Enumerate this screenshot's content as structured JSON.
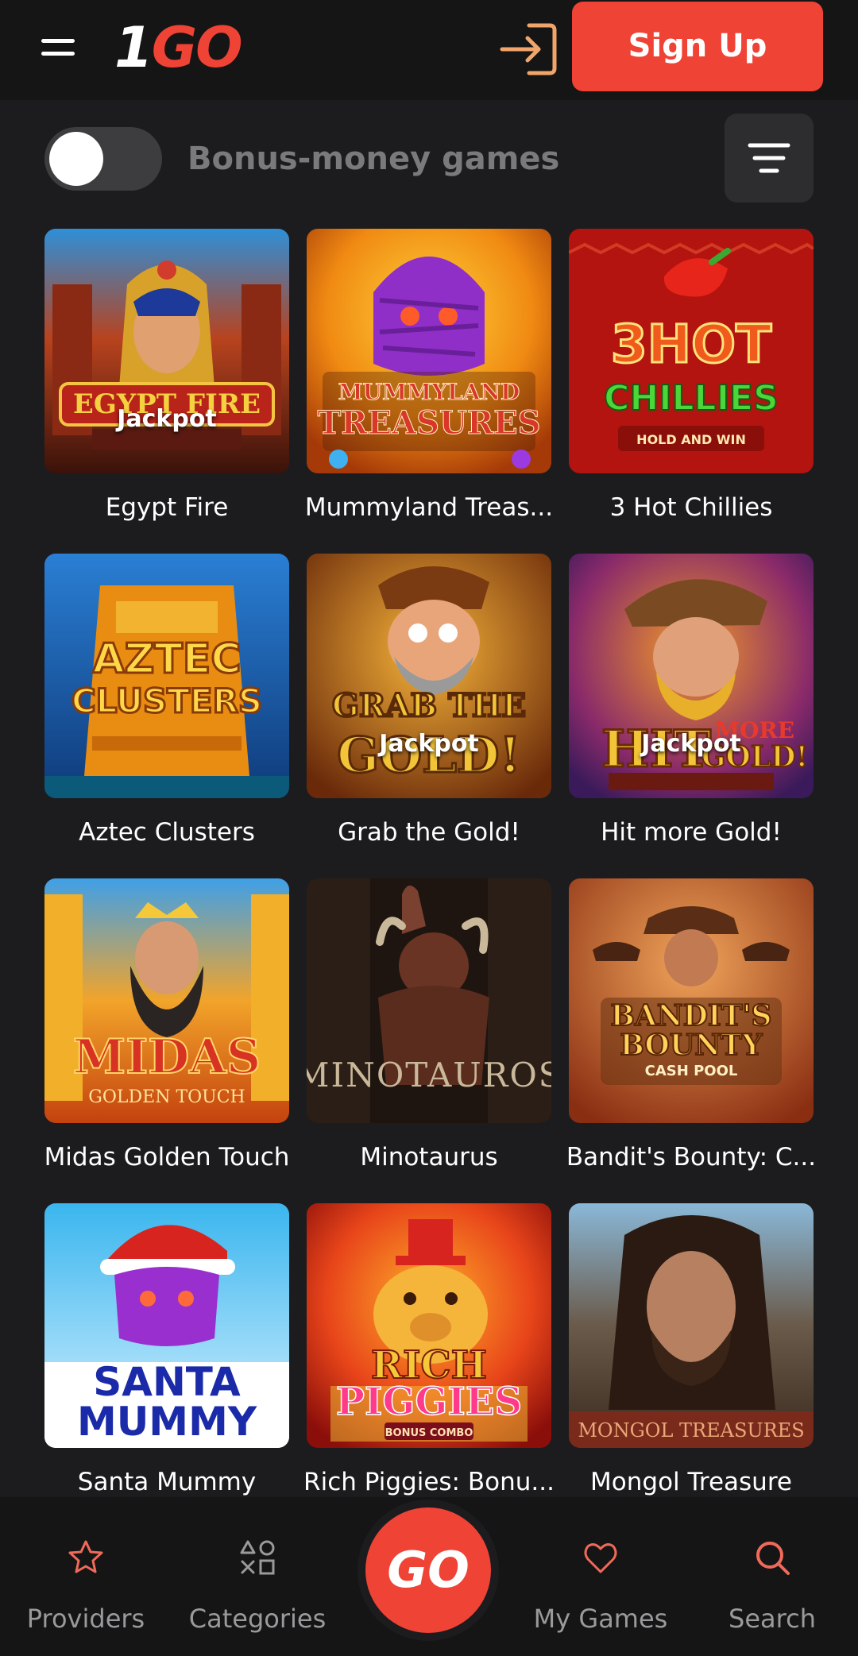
{
  "header": {
    "logo_one": "1",
    "logo_go": "GO",
    "signup_label": "Sign Up",
    "menu_icon": "hamburger-menu-icon",
    "login_icon": "login-icon"
  },
  "filters": {
    "bonus_toggle_label": "Bonus-money games",
    "bonus_toggle_on": false,
    "filter_icon": "filter-lines-icon"
  },
  "games": [
    {
      "name": "Egypt Fire",
      "badge": "Jackpot",
      "art_text": "EGYPT FIRE"
    },
    {
      "name": "Mummyland Treas...",
      "badge": "",
      "art_text": "MUMMYLAND TREASURES"
    },
    {
      "name": "3 Hot Chillies",
      "badge": "",
      "art_text": "3 HOT CHILLIES"
    },
    {
      "name": "Aztec Clusters",
      "badge": "",
      "art_text": "AZTEC CLUSTERS"
    },
    {
      "name": "Grab the Gold!",
      "badge": "Jackpot",
      "art_text": "GRAB THE GOLD!"
    },
    {
      "name": "Hit more Gold!",
      "badge": "Jackpot",
      "art_text": "HIT MORE GOLD!"
    },
    {
      "name": "Midas Golden Touch",
      "badge": "",
      "art_text": "MIDAS"
    },
    {
      "name": "Minotaurus",
      "badge": "",
      "art_text": "MINOTAUROS"
    },
    {
      "name": "Bandit's Bounty: C...",
      "badge": "",
      "art_text": "BANDIT'S BOUNTY"
    },
    {
      "name": "Santa Mummy",
      "badge": "",
      "art_text": "SANTA MUMMY"
    },
    {
      "name": "Rich Piggies: Bonu...",
      "badge": "",
      "art_text": "RICH PIGGIES"
    },
    {
      "name": "Mongol Treasure",
      "badge": "",
      "art_text": "MONGOL TREASURES"
    }
  ],
  "bottom_nav": {
    "providers": "Providers",
    "categories": "Categories",
    "go": "GO",
    "my_games": "My Games",
    "search": "Search"
  },
  "colors": {
    "accent": "#ef4335",
    "background": "#1c1c1e",
    "header": "#151515",
    "muted_text": "#9a9a9c"
  }
}
